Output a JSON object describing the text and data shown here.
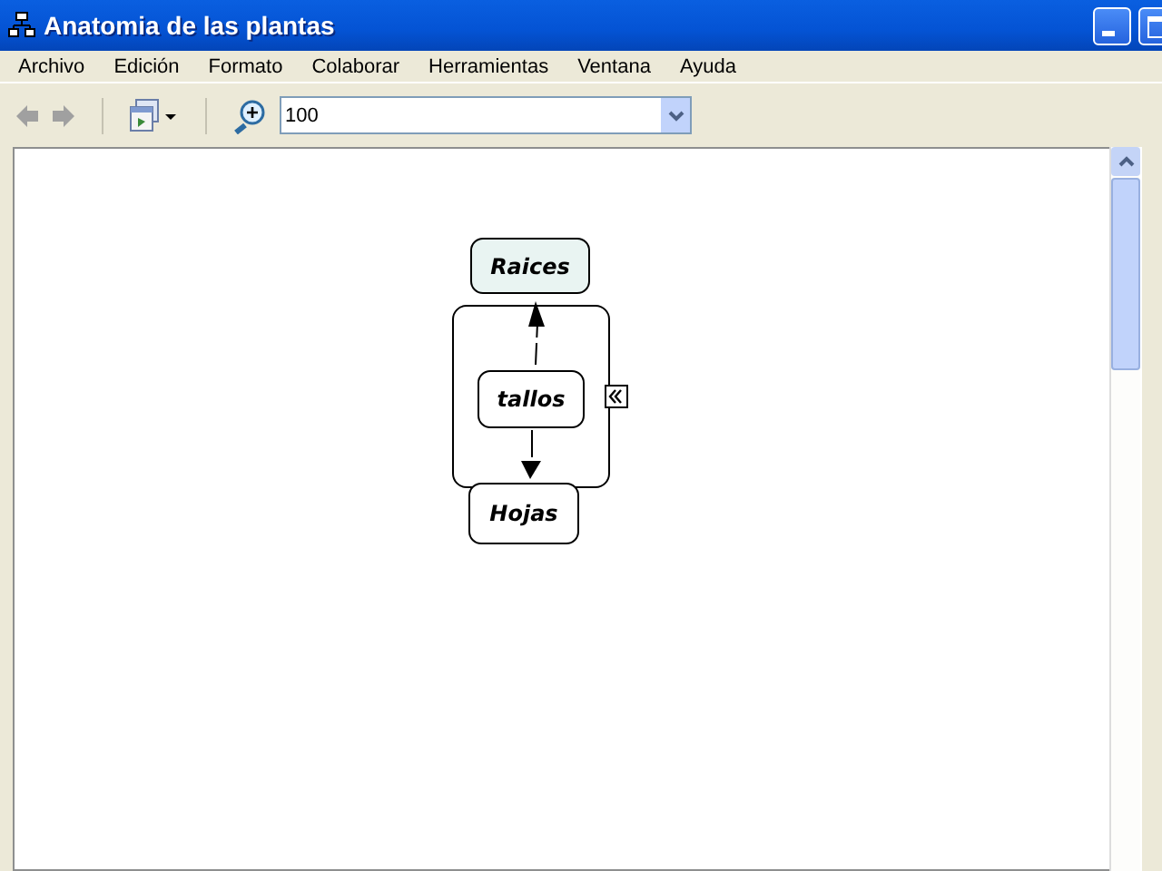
{
  "window": {
    "title": "Anatomia de las plantas"
  },
  "menu": [
    "Archivo",
    "Edición",
    "Formato",
    "Colaborar",
    "Herramientas",
    "Ventana",
    "Ayuda"
  ],
  "toolbar": {
    "zoom": {
      "value": "100"
    }
  },
  "concept_map": {
    "nodes": [
      {
        "label": "Raices",
        "highlighted": true
      },
      {
        "label": "tallos",
        "highlighted": false
      },
      {
        "label": "Hojas",
        "highlighted": false
      }
    ],
    "group": {
      "collapse_button": true
    }
  }
}
